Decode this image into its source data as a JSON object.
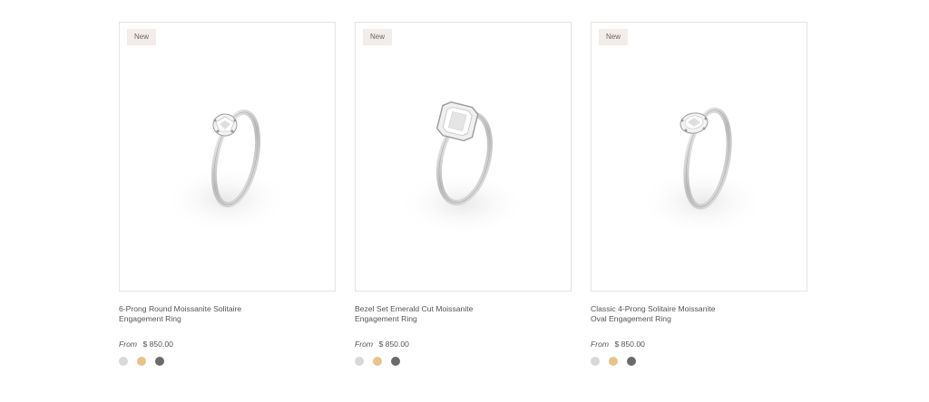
{
  "products": [
    {
      "badge": "New",
      "title_line1": "6-Prong Round Moissanite Solitaire",
      "title_line2": "Engagement Ring",
      "from_label": "From",
      "price": "$ 850.00",
      "stone": "round",
      "swatches": [
        {
          "name": "white-gold",
          "color": "#d8d8d8"
        },
        {
          "name": "yellow-gold",
          "color": "#e8c48a"
        },
        {
          "name": "dark-metal",
          "color": "#6b6b6b"
        }
      ]
    },
    {
      "badge": "New",
      "title_line1": "Bezel Set Emerald Cut Moissanite",
      "title_line2": "Engagement Ring",
      "from_label": "From",
      "price": "$ 850.00",
      "stone": "emerald",
      "swatches": [
        {
          "name": "white-gold",
          "color": "#d8d8d8"
        },
        {
          "name": "yellow-gold",
          "color": "#e8c48a"
        },
        {
          "name": "dark-metal",
          "color": "#6b6b6b"
        }
      ]
    },
    {
      "badge": "New",
      "title_line1": "Classic 4-Prong Solitaire Moissanite",
      "title_line2": "Oval Engagement Ring",
      "from_label": "From",
      "price": "$ 850.00",
      "stone": "oval",
      "swatches": [
        {
          "name": "white-gold",
          "color": "#d8d8d8"
        },
        {
          "name": "yellow-gold",
          "color": "#e8c48a"
        },
        {
          "name": "dark-metal",
          "color": "#6b6b6b"
        }
      ]
    }
  ]
}
